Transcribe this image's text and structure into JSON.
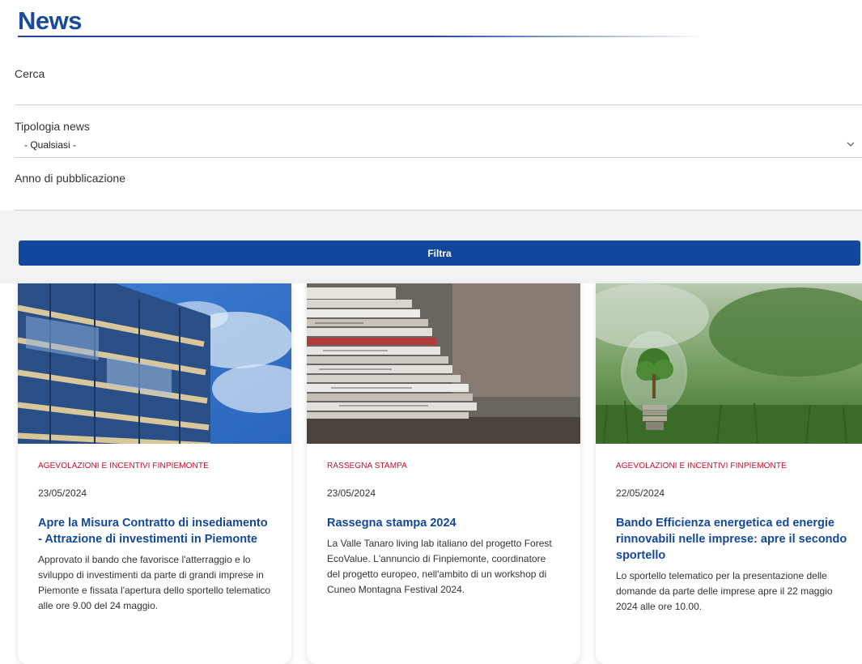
{
  "page": {
    "title": "News"
  },
  "filters": {
    "search_label": "Cerca",
    "type_label": "Tipologia news",
    "type_value": "- Qualsiasi -",
    "year_label": "Anno di pubblicazione",
    "filter_button": "Filtra"
  },
  "cards": [
    {
      "category": "AGEVOLAZIONI E INCENTIVI FINPIEMONTE",
      "date": "23/05/2024",
      "title": "Apre la Misura Contratto di insediamento - Attrazione di investimenti in Piemonte",
      "text": "Approvato il bando che favorisce l'atterraggio e lo sviluppo di investimenti da parte di grandi imprese in Piemonte e fissata l'apertura dello sportello telematico alle ore 9.00 del 24 maggio."
    },
    {
      "category": "RASSEGNA STAMPA",
      "date": "23/05/2024",
      "title": "Rassegna stampa 2024",
      "text": "La Valle Tanaro living lab italiano del progetto Forest EcoValue. L'annuncio di Finpiemonte, coordinatore del progetto europeo, nell'ambito di un workshop di Cuneo Montagna Festival 2024."
    },
    {
      "category": "AGEVOLAZIONI E INCENTIVI FINPIEMONTE",
      "date": "22/05/2024",
      "title": "Bando Efficienza energetica ed energie rinnovabili nelle imprese: apre il secondo sportello",
      "text": "Lo sportello telematico per la presentazione delle domande da parte delle imprese apre il 22 maggio 2024 alle ore 10.00."
    }
  ]
}
